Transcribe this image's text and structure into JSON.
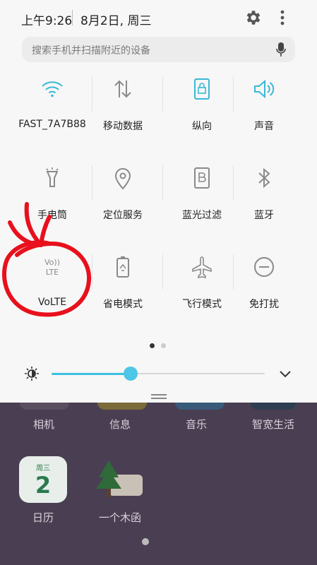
{
  "status": {
    "time": "上午9:26",
    "date": "8月2日, 周三"
  },
  "search": {
    "placeholder": "搜索手机并扫描附近的设备"
  },
  "tiles": [
    {
      "label": "FAST_7A7B88",
      "icon": "wifi-icon"
    },
    {
      "label": "移动数据",
      "icon": "mobile-data-icon"
    },
    {
      "label": "纵向",
      "icon": "portrait-lock-icon"
    },
    {
      "label": "声音",
      "icon": "sound-icon"
    },
    {
      "label": "手电筒",
      "icon": "flashlight-icon"
    },
    {
      "label": "定位服务",
      "icon": "location-icon"
    },
    {
      "label": "蓝光过滤",
      "icon": "blue-light-filter-icon"
    },
    {
      "label": "蓝牙",
      "icon": "bluetooth-icon"
    },
    {
      "label": "VoLTE",
      "icon": "volte-icon",
      "icon_text_1": "Vo))",
      "icon_text_2": "LTE"
    },
    {
      "label": "省电模式",
      "icon": "battery-saver-icon"
    },
    {
      "label": "飞行模式",
      "icon": "airplane-icon"
    },
    {
      "label": "免打扰",
      "icon": "do-not-disturb-icon"
    }
  ],
  "page_indicator": {
    "current": 1,
    "total": 2
  },
  "brightness": {
    "level": 0.37
  },
  "home_apps": [
    {
      "label": "相机"
    },
    {
      "label": "信息"
    },
    {
      "label": "音乐"
    },
    {
      "label": "智宽生活"
    },
    {
      "label": "日历",
      "icon_week": "周三",
      "icon_day": "2"
    },
    {
      "label": "一个木函"
    }
  ],
  "colors": {
    "accent": "#3cc0e0",
    "tile_icon": "#3ab8d6",
    "tile_icon_inactive": "#8a8a8a",
    "annotation": "#e8101c"
  }
}
